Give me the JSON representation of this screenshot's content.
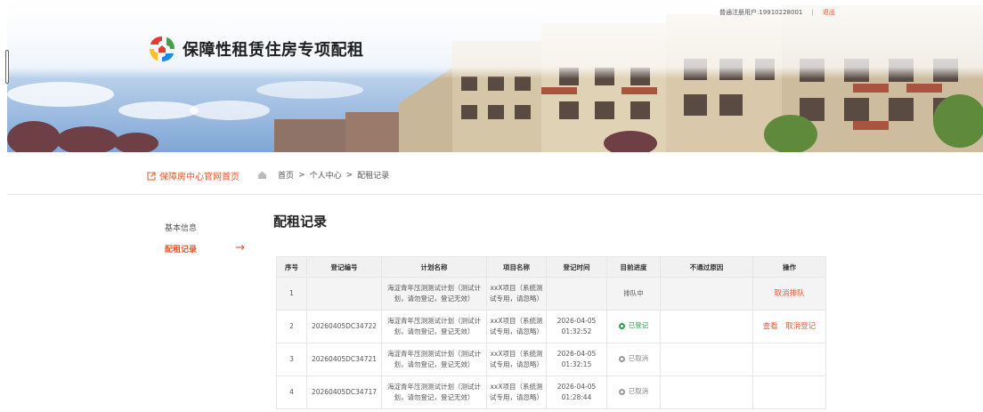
{
  "header": {
    "user_label": "普通注册用户:19910228001",
    "separator": "|",
    "logout": "退出",
    "site_title": "保障性租赁住房专项配租"
  },
  "breadcrumb": {
    "home_link": "保障房中心官网首页",
    "items": [
      "首页",
      "个人中心",
      "配租记录"
    ],
    "separator": ">"
  },
  "sidebar": {
    "items": [
      {
        "label": "基本信息"
      },
      {
        "label": "配租记录",
        "arrow": "→"
      }
    ]
  },
  "main": {
    "title": "配租记录",
    "columns": [
      "序号",
      "登记编号",
      "计划名称",
      "项目名称",
      "登记时间",
      "目前进度",
      "不通过原因",
      "操作"
    ],
    "rows": [
      {
        "no": "1",
        "code": "",
        "plan": "海淀青年压测测试计划（测试计划，请勿登记，登记无效）",
        "project": "xxX项目（系统测试专用，请忽略）",
        "time": "",
        "status": "排队中",
        "reason": "",
        "actions": [
          "取消排队"
        ]
      },
      {
        "no": "2",
        "code": "20260405DC34722",
        "plan": "海淀青年压测测试计划（测试计划，请勿登记，登记无效）",
        "project": "xxX项目（系统测试专用，请忽略）",
        "time": "2026-04-05 01:32:52",
        "status": "已登记",
        "reason": "",
        "actions": [
          "查看",
          "取消登记"
        ]
      },
      {
        "no": "3",
        "code": "20260405DC34721",
        "plan": "海淀青年压测测试计划（测试计划，请勿登记，登记无效）",
        "project": "xxX项目（系统测试专用，请忽略）",
        "time": "2026-04-05 01:32:15",
        "status": "已取消",
        "reason": "",
        "actions": []
      },
      {
        "no": "4",
        "code": "20260405DC34717",
        "plan": "海淀青年压测测试计划（测试计划，请勿登记，登记无效）",
        "project": "xxX项目（系统测试专用，请忽略）",
        "time": "2026-04-05 01:28:44",
        "status": "已取消",
        "reason": "",
        "actions": []
      }
    ]
  },
  "colors": {
    "accent": "#e8562a",
    "success": "#2a9d4b",
    "muted": "#999999"
  }
}
